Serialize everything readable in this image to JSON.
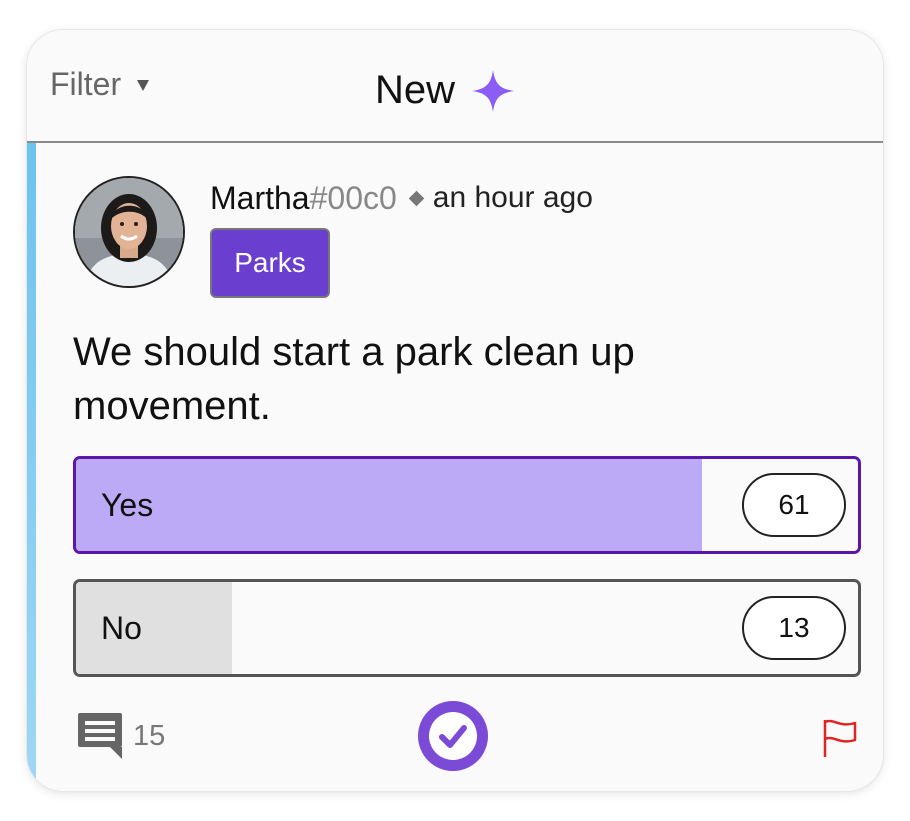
{
  "header": {
    "filter_label": "Filter",
    "title": "New",
    "sparkle_icon": "sparkle-icon",
    "accent_color": "#8b5cf6"
  },
  "post": {
    "author": {
      "name": "Martha",
      "tag": "#00c0",
      "avatar": "avatar-photo"
    },
    "timestamp": "an hour ago",
    "category": "Parks",
    "text": "We should start a park clean up movement.",
    "poll": {
      "options": [
        {
          "label": "Yes",
          "count": "61",
          "fill_fraction": 0.8
        },
        {
          "label": "No",
          "count": "13",
          "fill_fraction": 0.2
        }
      ]
    },
    "footer": {
      "comment_count": "15",
      "comment_icon": "comment-icon",
      "vote_icon": "check-circle-icon",
      "report_icon": "flag-icon"
    }
  },
  "colors": {
    "category_badge": "#6a3fd0",
    "yes_border": "#5b17a8",
    "yes_fill": "#bcaaf7",
    "no_fill": "#e0e0e0",
    "check_button": "#7b4bd8",
    "flag": "#e02424",
    "accent_bar": "#6cc3ee"
  }
}
